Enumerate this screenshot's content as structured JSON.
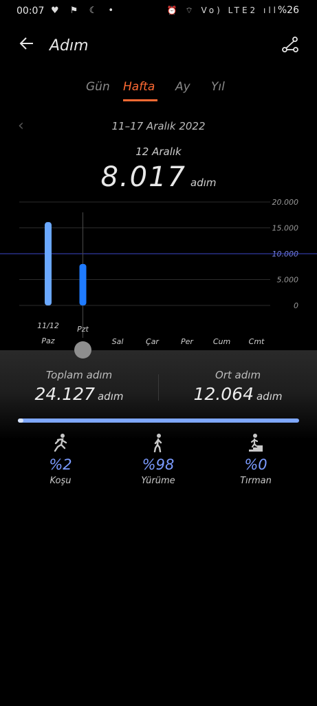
{
  "status_bar": {
    "time": "00:07",
    "left_icons": "♥ ⚑ ☾ •",
    "right_icons": "⏰ ⌔ Vo) LTE2 ıll",
    "battery": "%26"
  },
  "header": {
    "title": "Adım",
    "back_icon": "arrow-left-icon",
    "share_icon": "share-icon"
  },
  "tabs": [
    {
      "label": "Gün",
      "active": false
    },
    {
      "label": "Hafta",
      "active": true
    },
    {
      "label": "Ay",
      "active": false
    },
    {
      "label": "Yıl",
      "active": false
    }
  ],
  "accent_color": "#ff6a33",
  "date_range": "11–17 Aralık 2022",
  "selected": {
    "date": "12 Aralık",
    "steps": "8.017",
    "unit": "adım"
  },
  "chart_data": {
    "type": "bar",
    "categories": [
      "Paz",
      "Pzt",
      "Sal",
      "Çar",
      "Per",
      "Cum",
      "Cmt"
    ],
    "category_dates": [
      "11/12",
      "",
      "",
      "",
      "",
      "",
      ""
    ],
    "values": [
      16110,
      8017,
      0,
      0,
      0,
      0,
      0
    ],
    "selected_index": 1,
    "yticks": [
      "20.000",
      "15.000",
      "10.000",
      "5.000",
      "0"
    ],
    "ylim": [
      0,
      20000
    ],
    "goal_line": 10000,
    "colors": {
      "bar": "#6aa8ff",
      "selected_bar": "#1f7bff",
      "goal": "#3b46c8"
    }
  },
  "summary": {
    "total_label": "Toplam adım",
    "total_value": "24.127",
    "avg_label": "Ort adım",
    "avg_value": "12.064",
    "unit": "adım"
  },
  "progress": {
    "fill_fraction": 0.02
  },
  "activities": [
    {
      "label": "Koşu",
      "pct": "%2",
      "icon": "running-icon"
    },
    {
      "label": "Yürüme",
      "pct": "%98",
      "icon": "walking-icon"
    },
    {
      "label": "Tırman",
      "pct": "%0",
      "icon": "stairs-icon"
    }
  ]
}
